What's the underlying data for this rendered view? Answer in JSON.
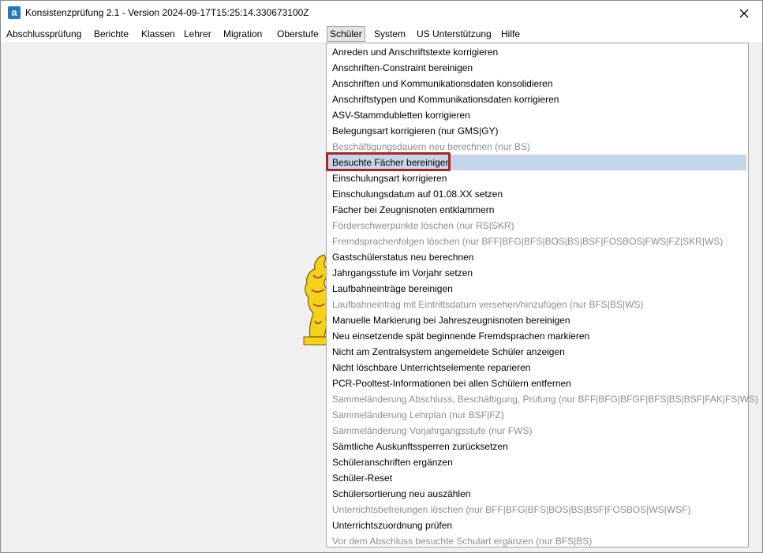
{
  "window": {
    "title": "Konsistenzprüfung 2.1 - Version 2024-09-17T15:25:14.330673100Z",
    "app_icon_letter": "a",
    "close_glyph": "✕"
  },
  "menubar": {
    "items": [
      {
        "label": "Abschlussprüfung"
      },
      {
        "label": "Berichte"
      },
      {
        "label": "Klassen"
      },
      {
        "label": "Lehrer"
      },
      {
        "label": "Migration"
      },
      {
        "label": "Oberstufe"
      },
      {
        "label": "Schüler"
      },
      {
        "label": "System"
      },
      {
        "label": "US Unterstützung"
      },
      {
        "label": "Hilfe"
      }
    ],
    "active": "Schüler"
  },
  "dropdown": {
    "items": [
      {
        "label": "Anreden und Anschriftstexte korrigieren",
        "enabled": true
      },
      {
        "label": "Anschriften-Constraint bereinigen",
        "enabled": true
      },
      {
        "label": "Anschriften und Kommunikationsdaten konsolidieren",
        "enabled": true
      },
      {
        "label": "Anschriftstypen und Kommunikationsdaten korrigieren",
        "enabled": true
      },
      {
        "label": "ASV-Stammdubletten korrigieren",
        "enabled": true
      },
      {
        "label": "Belegungsart korrigieren (nur GMS|GY)",
        "enabled": true
      },
      {
        "label": "Beschäftigungsdauern neu berechnen (nur BS)",
        "enabled": false
      },
      {
        "label": "Besuchte Fächer bereinigen",
        "enabled": true,
        "hover": true
      },
      {
        "label": "Einschulungsart korrigieren",
        "enabled": true
      },
      {
        "label": "Einschulungsdatum auf 01.08.XX setzen",
        "enabled": true
      },
      {
        "label": "Fächer bei Zeugnisnoten entklammern",
        "enabled": true
      },
      {
        "label": "Förderschwerpunkte löschen (nur RS|SKR)",
        "enabled": false
      },
      {
        "label": "Fremdsprachenfolgen löschen (nur BFF|BFG|BFS|BOS|BS|BSF|FOSBOS|FWS|FZ|SKR|WS)",
        "enabled": false
      },
      {
        "label": "Gastschülerstatus neu berechnen",
        "enabled": true
      },
      {
        "label": "Jahrgangsstufe im Vorjahr setzen",
        "enabled": true
      },
      {
        "label": "Laufbahneinträge bereinigen",
        "enabled": true
      },
      {
        "label": "Laufbahneintrag mit Eintrittsdatum versehen/hinzufügen (nur BFS|BS|WS)",
        "enabled": false
      },
      {
        "label": "Manuelle Markierung bei Jahreszeugnisnoten bereinigen",
        "enabled": true
      },
      {
        "label": "Neu einsetzende spät beginnende Fremdsprachen markieren",
        "enabled": true
      },
      {
        "label": "Nicht am Zentralsystem angemeldete Schüler anzeigen",
        "enabled": true
      },
      {
        "label": "Nicht löschbare Unterrichtselemente reparieren",
        "enabled": true
      },
      {
        "label": "PCR-Pooltest-Informationen bei allen Schülern entfernen",
        "enabled": true
      },
      {
        "label": "Sammeländerung Abschluss, Beschäftigung, Prüfung (nur BFF|BFG|BFGF|BFS|BS|BSF|FAK|FS|WS)",
        "enabled": false
      },
      {
        "label": "Sammeländerung Lehrplan (nur BSF|FZ)",
        "enabled": false
      },
      {
        "label": "Sammeländerung Vorjahrgangsstufe (nur FWS)",
        "enabled": false
      },
      {
        "label": "Sämtliche Auskunftssperren zurücksetzen",
        "enabled": true
      },
      {
        "label": "Schüleranschriften ergänzen",
        "enabled": true
      },
      {
        "label": "Schüler-Reset",
        "enabled": true
      },
      {
        "label": "Schülersortierung neu auszählen",
        "enabled": true
      },
      {
        "label": "Unterrichtsbefreiungen löschen (nur BFF|BFG|BFS|BOS|BS|BSF|FOSBOS|WS|WSF)",
        "enabled": false
      },
      {
        "label": "Unterrichtszuordnung prüfen",
        "enabled": true
      },
      {
        "label": "Vor dem Abschluss besuchte Schulart ergänzen (nur BFS|BS)",
        "enabled": false
      }
    ]
  },
  "colors": {
    "hover_bg": "#c5d5ea",
    "disabled_text": "#8d8d8d",
    "highlight_border": "#b22222",
    "lion_gold": "#f2d21b"
  },
  "icons": {
    "app": "app-logo-icon",
    "close": "close-icon",
    "background": "lion-emblem-icon"
  }
}
